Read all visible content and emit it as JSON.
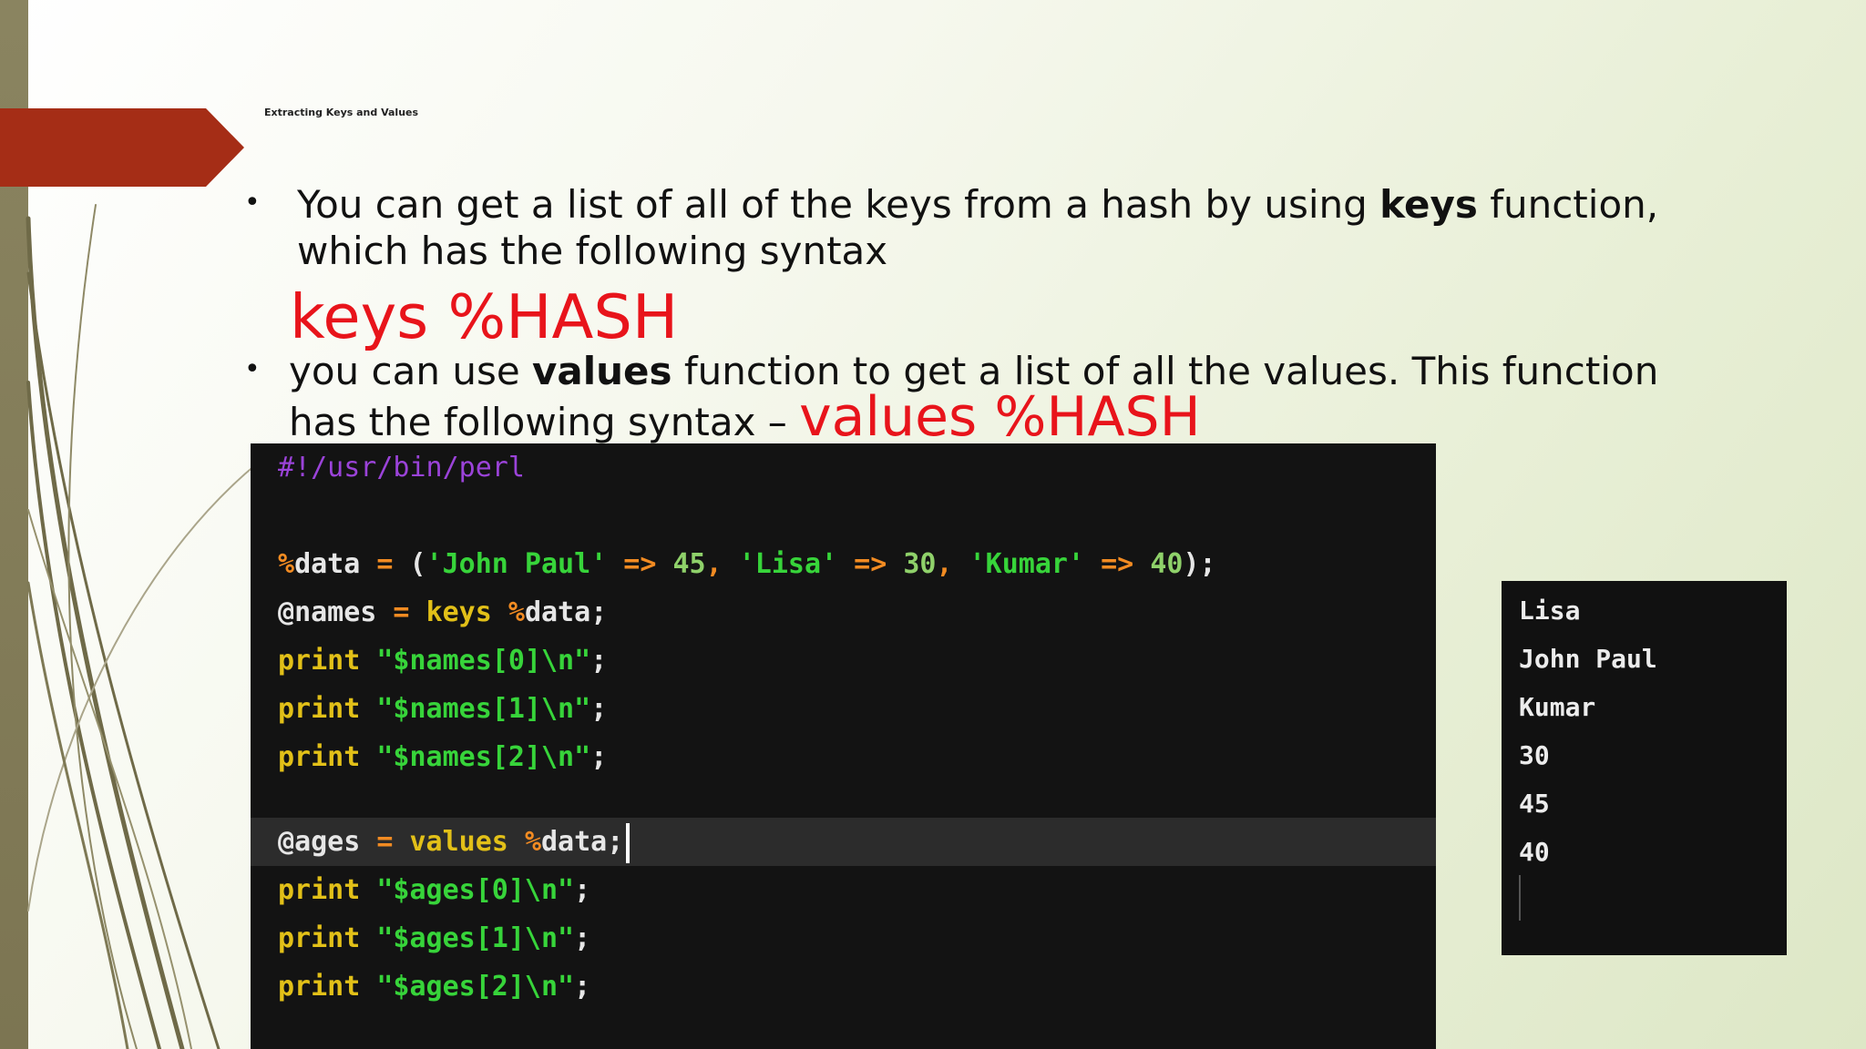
{
  "slide": {
    "title": "Extracting Keys and Values"
  },
  "bullets": [
    {
      "pre": "You can get a list of all of the keys from a hash by using ",
      "bold": "keys",
      "post": " function,",
      "line2": "which has the following syntax"
    },
    {
      "pre": "you can use ",
      "bold": "values",
      "post": " function to get a list of all the values. This function",
      "line2": "has the following syntax – "
    }
  ],
  "syntax": {
    "keys": "keys %HASH",
    "values": "values %HASH"
  },
  "code": {
    "shebang": "#!/usr/bin/perl",
    "l3": {
      "sig": "%",
      "id": "data",
      "eq": " = ",
      "open": "(",
      "s1": "'John Paul'",
      "arr1": " => ",
      "n1": "45",
      "c1": ", ",
      "s2": "'Lisa'",
      "arr2": " => ",
      "n2": "30",
      "c2": ", ",
      "s3": "'Kumar'",
      "arr3": " => ",
      "n3": "40",
      "close": ");"
    },
    "l4": {
      "sig": "@",
      "id": "names",
      "eq": " = ",
      "kw": "keys",
      "sp": " ",
      "sig2": "%",
      "id2": "data",
      "end": ";"
    },
    "prints1": [
      {
        "kw": "print",
        "sp": " ",
        "str": "\"$names[0]\\n\"",
        "end": ";"
      },
      {
        "kw": "print",
        "sp": " ",
        "str": "\"$names[1]\\n\"",
        "end": ";"
      },
      {
        "kw": "print",
        "sp": " ",
        "str": "\"$names[2]\\n\"",
        "end": ";"
      }
    ],
    "l9": {
      "sig": "@",
      "id": "ages",
      "eq": " = ",
      "kw": "values",
      "sp": " ",
      "sig2": "%",
      "id2": "data",
      "end": ";"
    },
    "prints2": [
      {
        "kw": "print",
        "sp": " ",
        "str": "\"$ages[0]\\n\"",
        "end": ";"
      },
      {
        "kw": "print",
        "sp": " ",
        "str": "\"$ages[1]\\n\"",
        "end": ";"
      },
      {
        "kw": "print",
        "sp": " ",
        "str": "\"$ages[2]\\n\"",
        "end": ";"
      }
    ]
  },
  "output": [
    "Lisa",
    "John Paul",
    "Kumar",
    "30",
    "45",
    "40"
  ],
  "colors": {
    "accent_banner": "#a52d16",
    "syntax_red": "#e8141b",
    "code_bg": "#131313",
    "keyword": "#e2c018",
    "string": "#37d43a",
    "operator": "#f28b22",
    "comment": "#9b43d9"
  }
}
